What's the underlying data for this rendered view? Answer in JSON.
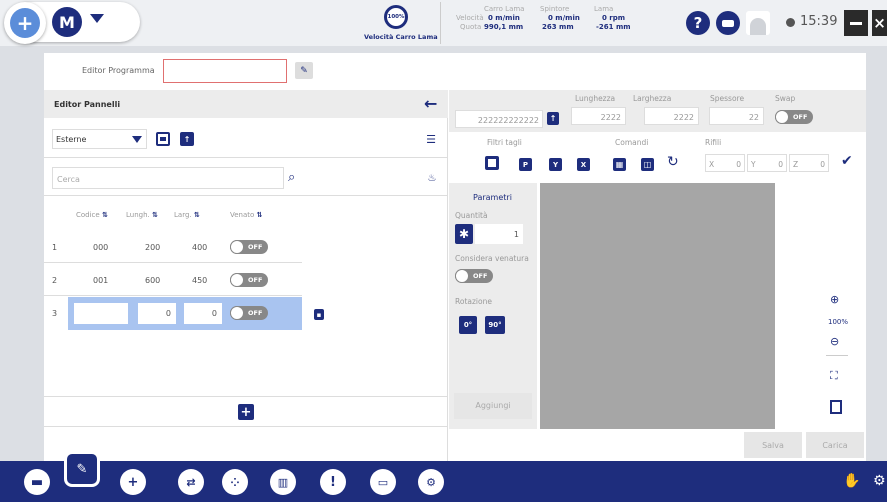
{
  "colors": {
    "primary": "#1e2d7d",
    "accent": "#5b8dd9",
    "selected": "#a9c4f0"
  },
  "topbar": {
    "menu_icon": "plus-circle-icon",
    "logo_text": "M",
    "speed_pct": "100%",
    "speed_label": "Velocità Carro Lama",
    "status": {
      "col1_label": "Carro Lama",
      "col2_label": "Spintore",
      "col3_label": "Lama",
      "row1_label": "Velocità",
      "row2_label": "Quota",
      "velocita": [
        "0 m/min",
        "0 m/min",
        "0 rpm"
      ],
      "quota": [
        "990,1 mm",
        "263 mm",
        "-261 mm"
      ]
    },
    "time": "15:39"
  },
  "editor_programma": {
    "label": "Editor Programma",
    "value": ""
  },
  "editor_pannelli": {
    "title": "Editor Pannelli",
    "filter": "Esterne",
    "search_placeholder": "Cerca",
    "columns": [
      "Codice",
      "Lungh.",
      "Larg.",
      "Venato"
    ],
    "rows": [
      {
        "num": "1",
        "codice": "000",
        "lungh": "200",
        "larg": "400",
        "venato": "OFF"
      },
      {
        "num": "2",
        "codice": "001",
        "lungh": "600",
        "larg": "450",
        "venato": "OFF"
      },
      {
        "num": "3",
        "codice": "",
        "lungh": "0",
        "larg": "0",
        "venato": "OFF"
      }
    ]
  },
  "top_fields": {
    "code": "222222222222",
    "lunghezza_label": "Lunghezza",
    "lunghezza": "2222",
    "larghezza_label": "Larghezza",
    "larghezza": "2222",
    "spessore_label": "Spessore",
    "spessore": "22",
    "swap_label": "Swap",
    "swap": "OFF"
  },
  "filters": {
    "filtri_label": "Filtri tagli",
    "p": "P",
    "y": "Y",
    "x": "X",
    "comandi_label": "Comandi",
    "rifili_label": "Rifili",
    "x_label": "X",
    "x_val": "0",
    "y_label": "Y",
    "y_val": "0",
    "z_label": "Z",
    "z_val": "0"
  },
  "parametri": {
    "title": "Parametri",
    "quantita_label": "Quantità",
    "quantita": "1",
    "venatura_label": "Considera venatura",
    "venatura": "OFF",
    "rotazione_label": "Rotazione",
    "rot0": "0°",
    "rot90": "90°",
    "aggiungi": "Aggiungi"
  },
  "zoom": "100%",
  "actions": {
    "salva": "Salva",
    "carica": "Carica"
  }
}
